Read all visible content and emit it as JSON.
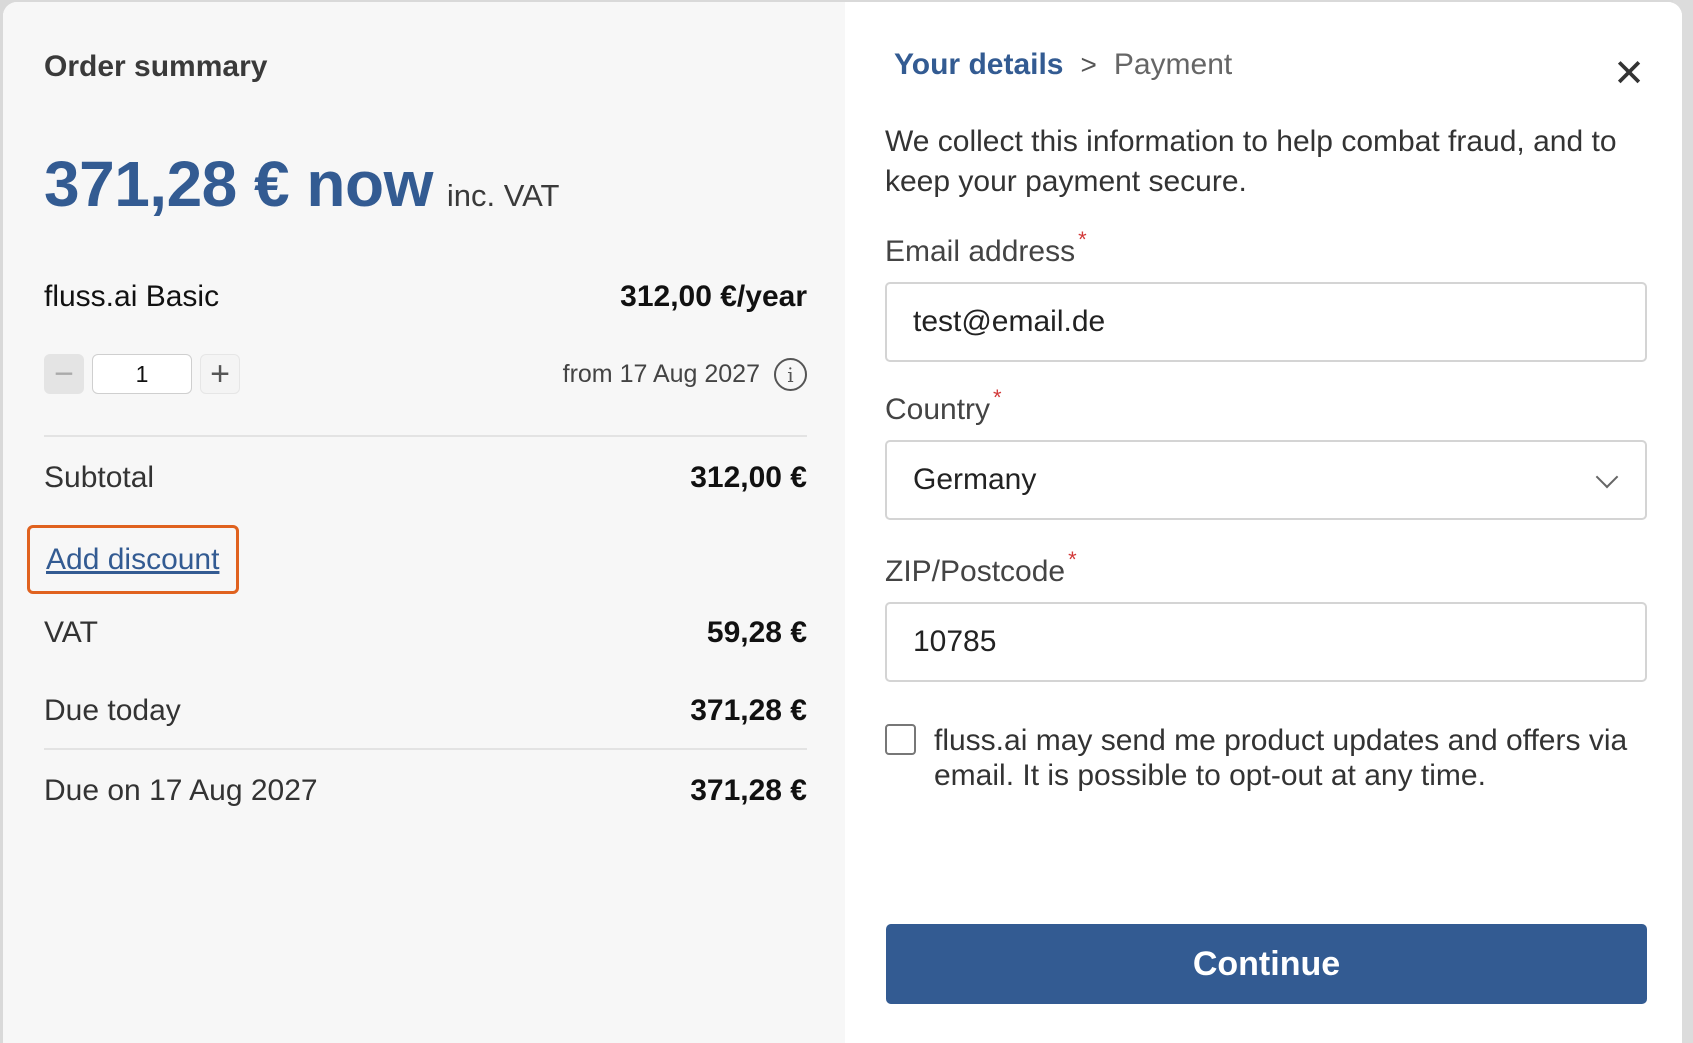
{
  "order": {
    "title": "Order summary",
    "total_now": "371,28 € now",
    "inc_vat": "inc. VAT",
    "product_name": "fluss.ai Basic",
    "product_price": "312,00 €/year",
    "quantity": "1",
    "from_date": "from 17 Aug 2027",
    "subtotal_label": "Subtotal",
    "subtotal_value": "312,00 €",
    "add_discount": "Add discount",
    "vat_label": "VAT",
    "vat_value": "59,28 €",
    "due_today_label": "Due today",
    "due_today_value": "371,28 €",
    "due_later_label": "Due on 17 Aug 2027",
    "due_later_value": "371,28 €"
  },
  "details": {
    "breadcrumb_active": "Your details",
    "breadcrumb_sep": ">",
    "breadcrumb_next": "Payment",
    "close_symbol": "✕",
    "intro": "We collect this information to help combat fraud, and to keep your payment secure.",
    "email_label": "Email address",
    "email_value": "test@email.de",
    "country_label": "Country",
    "country_value": "Germany",
    "zip_label": "ZIP/Postcode",
    "zip_value": "10785",
    "required_mark": "*",
    "marketing_consent": "fluss.ai may send me product updates and offers via email. It is possible to opt-out at any time.",
    "continue_label": "Continue"
  },
  "icons": {
    "minus": "−",
    "plus": "+",
    "info": "i"
  },
  "colors": {
    "brand_blue": "#335b92",
    "highlight_orange": "#e0621f",
    "required_red": "#d23a3a"
  }
}
